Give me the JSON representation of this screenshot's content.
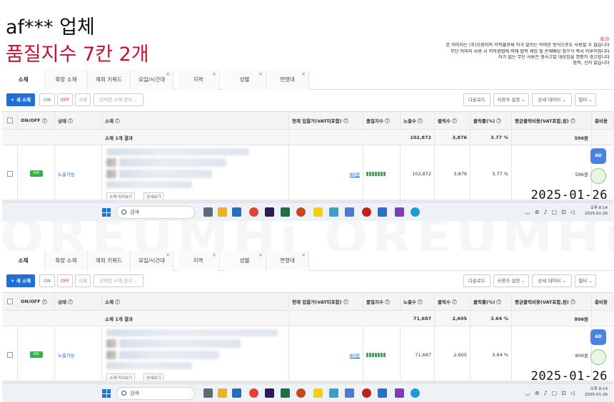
{
  "header": {
    "line1": "af*** 업체",
    "line2": "품질지수 7칸 2개"
  },
  "notice": {
    "title": "경고!",
    "lines": [
      "본 이미지는 (주)오름이의 저작물로써 허가 없이는 어떠한 방식으로도 사용할 수 없습니다",
      "무단 이미지 사용 시 저작권법에 의해 법적 제임 및 손해배상 청구가 즉시 이루어집니다",
      "허가 없는 무단 사용은 형사고발 대상임을 명중히 경고합니다",
      "함의, 선처 없습니다"
    ]
  },
  "watermark": "OREUMHi OREUMHi",
  "colors": {
    "accent": "#1f6fd6",
    "on": "#2fb344",
    "headline_red": "#c8102e"
  },
  "tabs": [
    "소재",
    "확장 소재",
    "제외 키워드",
    "요일/시간대",
    "지역",
    "성별",
    "연령대"
  ],
  "toolbar": {
    "new_label": "+ 새 소재",
    "on_label": "ON",
    "off_label": "OFF",
    "delete_label": "삭제",
    "select_label": "선택한 소재 관리",
    "download_label": "다운로드",
    "user_setting_label": "사용자 설정",
    "detail_data_label": "상세 데이터",
    "filter_label": "필터"
  },
  "columns": [
    "ON/OFF",
    "상태",
    "소재",
    "현재 입찰가(VAT미포함)",
    "품질지수",
    "노출수",
    "클릭수",
    "클릭률(%)",
    "평균클릭비용(VAT포함,원)",
    "총비용"
  ],
  "screens": [
    {
      "summary_label": "소재 1개 결과",
      "summary": {
        "impressions": "102,872",
        "clicks": "3,876",
        "ctr": "3.77 %",
        "cpc": "596원"
      },
      "row": {
        "toggle": "ON",
        "status": "노출가능",
        "bid": "80원",
        "impressions": "102,872",
        "clicks": "3,876",
        "ctr": "3.77 %",
        "cpc": "596원"
      },
      "btn_preview": "소재 미리보기",
      "btn_detail": "상세보기",
      "date": "2025-01-26",
      "tray_time": "오후 8:14",
      "tray_date": "2025-01-26"
    },
    {
      "summary_label": "소재 1개 결과",
      "summary": {
        "impressions": "71,687",
        "clicks": "2,605",
        "ctr": "3.64 %",
        "cpc": "806원"
      },
      "row": {
        "toggle": "ON",
        "status": "노출가능",
        "bid": "80원",
        "impressions": "71,687",
        "clicks": "2,605",
        "ctr": "3.64 %",
        "cpc": "806원"
      },
      "btn_preview": "소재 미리보기",
      "btn_detail": "상세보기",
      "date": "2025-01-26",
      "tray_time": "오후 8:14",
      "tray_date": "2025-01-26"
    }
  ],
  "quality_index_bars": 7,
  "taskbar": {
    "search_placeholder": "검색"
  }
}
